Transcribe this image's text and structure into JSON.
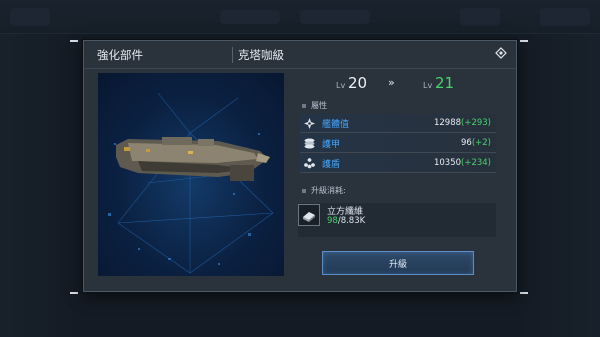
{
  "dialog": {
    "title": "強化部件",
    "subtitle": "克塔咖級"
  },
  "level": {
    "current_prefix": "Lv",
    "current": "20",
    "arrow": "»",
    "next_prefix": "Lv",
    "next": "21"
  },
  "attributes": {
    "heading": "屬性",
    "rows": [
      {
        "icon": "fleet-value-icon",
        "name": "艦體值",
        "base": "12988",
        "bonus": "(+293)"
      },
      {
        "icon": "armor-icon",
        "name": "護甲",
        "base": "96",
        "bonus": "(+2)"
      },
      {
        "icon": "shield-icon",
        "name": "護盾",
        "base": "10350",
        "bonus": "(+234)"
      }
    ]
  },
  "cost": {
    "heading": "升級消耗:",
    "item_name": "立方纖維",
    "have": "98",
    "need": "/8.83K"
  },
  "upgrade_button": {
    "label": "升級"
  },
  "colors": {
    "accent_blue": "#47a8ff",
    "bonus_green": "#47d36a",
    "next_level_green": "#47d36a"
  }
}
